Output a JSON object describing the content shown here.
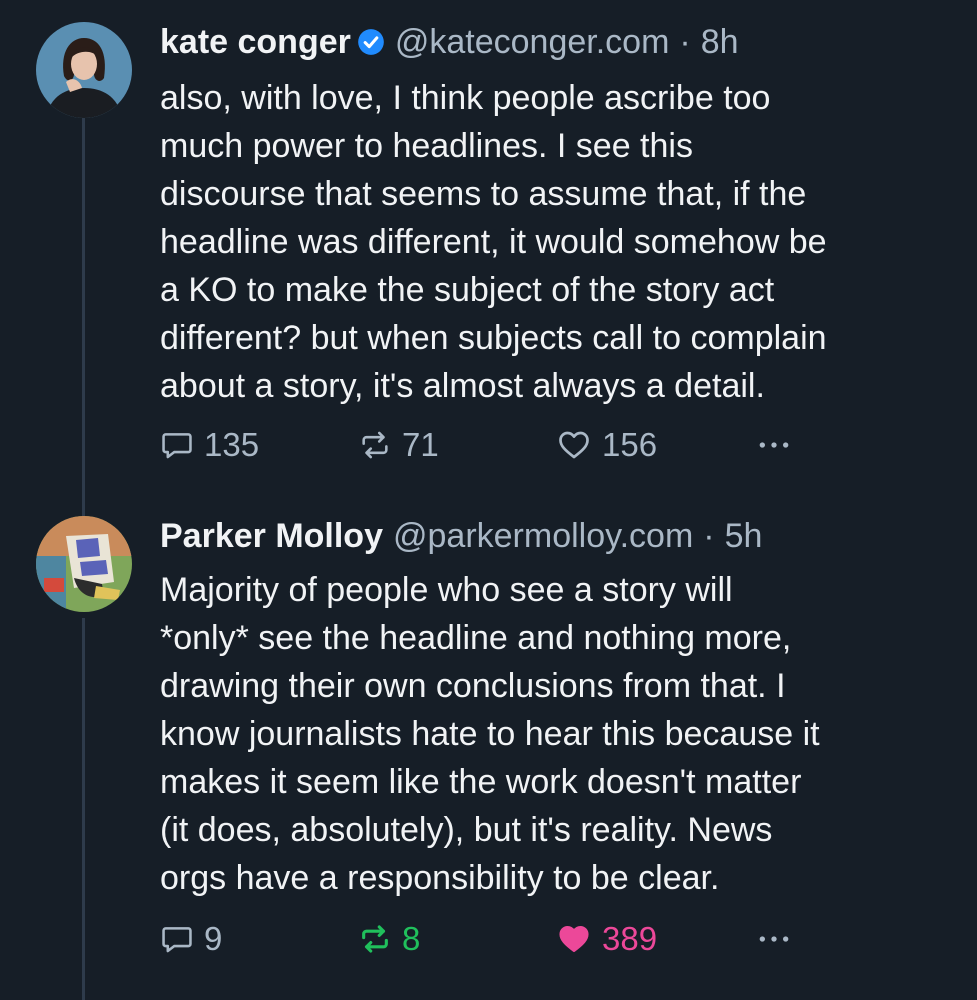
{
  "posts": [
    {
      "display_name": "kate conger",
      "verified": true,
      "handle": "@kateconger.com",
      "time": "8h",
      "text": "also, with love, I think people ascribe too\nmuch power to headlines. I see this\ndiscourse that seems to assume that, if the\nheadline was different, it would somehow be\na KO to make the subject of the story act\ndifferent? but when subjects call to complain\nabout a story, it's almost always a detail.",
      "replies": "135",
      "reposts": "71",
      "likes": "156",
      "reposted": false,
      "liked": false
    },
    {
      "display_name": "Parker Molloy",
      "verified": false,
      "handle": "@parkermolloy.com",
      "time": "5h",
      "text": "Majority of people who see a story will\n*only* see the headline and nothing more,\ndrawing their own conclusions from that. I\nknow journalists hate to hear this because it\nmakes it seem like the work doesn't matter\n(it does, absolutely), but it's reality. News\norgs have a responsibility to be clear.",
      "replies": "9",
      "reposts": "8",
      "likes": "389",
      "reposted": true,
      "liked": true
    }
  ],
  "separator": "·",
  "icons": {
    "reply": "speech-bubble-icon",
    "repost": "repost-arrows-icon",
    "like": "heart-icon",
    "more": "ellipsis-icon",
    "verified": "verified-check-icon"
  },
  "colors": {
    "background": "#161e27",
    "text": "#f1f3f5",
    "muted": "#aab8c6",
    "verified": "#208bfe",
    "reposted": "#20c05c",
    "liked": "#ec4899"
  }
}
